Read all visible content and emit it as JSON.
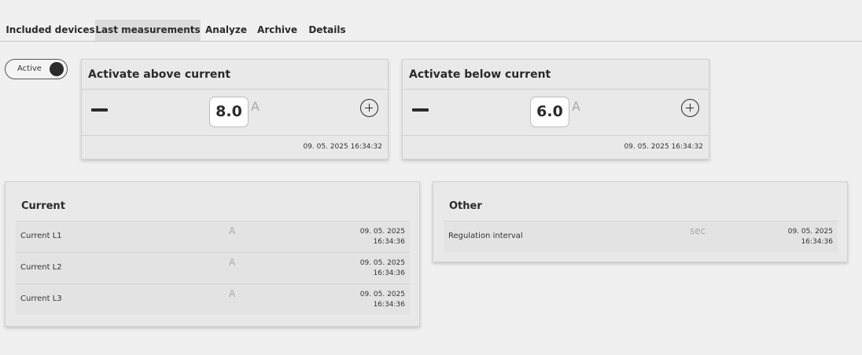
{
  "tabs": [
    {
      "label": "Included devices",
      "active": false
    },
    {
      "label": "Last measurements",
      "active": true
    },
    {
      "label": "Analyze",
      "active": false
    },
    {
      "label": "Archive",
      "active": false
    },
    {
      "label": "Details",
      "active": false
    }
  ],
  "toggle": {
    "label": "Active",
    "on": true
  },
  "controls": [
    {
      "title": "Activate above current",
      "value": "8.0",
      "unit": "A",
      "timestamp": "09. 05. 2025 16:34:32"
    },
    {
      "title": "Activate below current",
      "value": "6.0",
      "unit": "A",
      "timestamp": "09. 05. 2025 16:34:32"
    }
  ],
  "current_panel": {
    "title": "Current",
    "rows": [
      {
        "label": "Current L1",
        "unit": "A",
        "date": "09. 05. 2025",
        "time": "16:34:36"
      },
      {
        "label": "Current L2",
        "unit": "A",
        "date": "09. 05. 2025",
        "time": "16:34:36"
      },
      {
        "label": "Current L3",
        "unit": "A",
        "date": "09. 05. 2025",
        "time": "16:34:36"
      }
    ]
  },
  "other_panel": {
    "title": "Other",
    "rows": [
      {
        "label": "Regulation interval",
        "unit": "sec",
        "date": "09. 05. 2025",
        "time": "16:34:36"
      }
    ]
  },
  "icons": {
    "minus": "minus-icon",
    "plus": "plus-circle-icon"
  },
  "colors": {
    "background": "#f0f0f0",
    "active_tab": "#dcdcdc",
    "card": "#e9e9e9",
    "muted_unit": "#a9a9a9"
  }
}
